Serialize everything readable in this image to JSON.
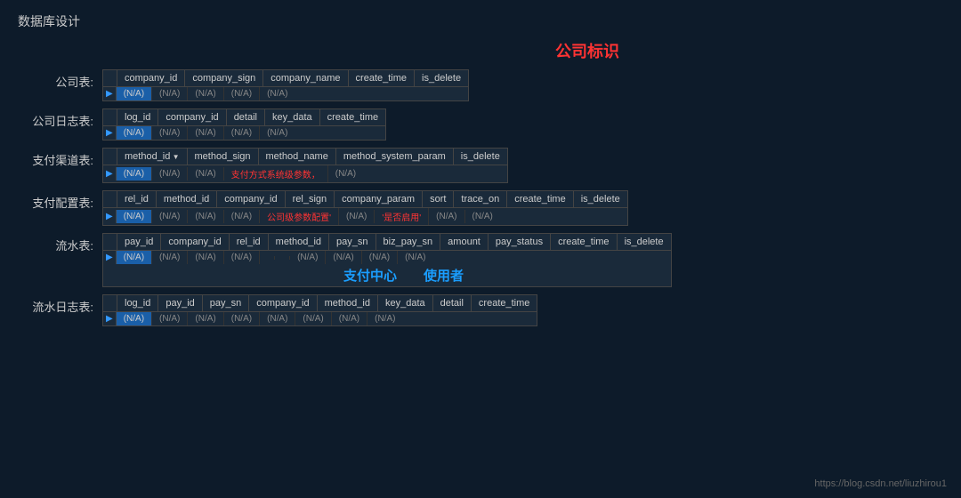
{
  "page": {
    "title": "数据库设计",
    "company_label": "公司标识",
    "watermark": "https://blog.csdn.net/liuzhirou1"
  },
  "sections": [
    {
      "id": "company",
      "label": "公司表:",
      "headers": [
        "company_id",
        "company_sign",
        "company_name",
        "create_time",
        "is_delete"
      ],
      "rows": [
        [
          "(N/A)",
          "(N/A)",
          "(N/A)",
          "(N/A)",
          "(N/A)"
        ]
      ],
      "highlighted_cols": [
        0
      ],
      "red_cols": [],
      "special_text": null
    },
    {
      "id": "company_log",
      "label": "公司日志表:",
      "headers": [
        "log_id",
        "company_id",
        "detail",
        "key_data",
        "create_time"
      ],
      "rows": [
        [
          "(N/A)",
          "(N/A)",
          "(N/A)",
          "(N/A)",
          "(N/A)"
        ]
      ],
      "highlighted_cols": [
        0
      ],
      "red_cols": [],
      "special_text": null
    },
    {
      "id": "pay_channel",
      "label": "支付渠道表:",
      "headers": [
        "method_id",
        "method_sign",
        "method_name",
        "method_system_param",
        "is_delete"
      ],
      "dropdown_col": 0,
      "rows": [
        [
          "(N/A)",
          "(N/A)",
          "(N/A)",
          "支付方式系统级参数，",
          "(N/A)"
        ]
      ],
      "highlighted_cols": [
        0
      ],
      "red_cols": [
        3
      ],
      "special_text": null
    },
    {
      "id": "pay_config",
      "label": "支付配置表:",
      "headers": [
        "rel_id",
        "method_id",
        "company_id",
        "rel_sign",
        "company_param",
        "sort",
        "trace_on",
        "create_time",
        "is_delete"
      ],
      "rows": [
        [
          "(N/A)",
          "(N/A)",
          "(N/A)",
          "(N/A)",
          "公司级参数配置'",
          "(N/A)",
          "'是否启用'",
          "(N/A)",
          "(N/A)"
        ]
      ],
      "highlighted_cols": [
        0
      ],
      "red_cols": [
        4,
        6
      ],
      "special_text": null
    },
    {
      "id": "flow",
      "label": "流水表:",
      "headers": [
        "pay_id",
        "company_id",
        "rel_id",
        "method_id",
        "pay_sn",
        "biz_pay_sn",
        "amount",
        "pay_status",
        "create_time",
        "is_delete"
      ],
      "rows": [
        [
          "(N/A)",
          "(N/A)",
          "(N/A)",
          "(N/A)",
          "",
          "",
          "(N/A)",
          "(N/A)",
          "(N/A)",
          "(N/A)"
        ]
      ],
      "highlighted_cols": [
        0
      ],
      "red_cols": [],
      "center_labels": [
        "支付中心",
        "使用者"
      ],
      "special_text": null
    },
    {
      "id": "flow_log",
      "label": "流水日志表:",
      "headers": [
        "log_id",
        "pay_id",
        "pay_sn",
        "company_id",
        "method_id",
        "key_data",
        "detail",
        "create_time"
      ],
      "rows": [
        [
          "(N/A)",
          "(N/A)",
          "(N/A)",
          "(N/A)",
          "(N/A)",
          "(N/A)",
          "(N/A)",
          "(N/A)"
        ]
      ],
      "highlighted_cols": [
        0
      ],
      "red_cols": [],
      "special_text": null
    }
  ]
}
